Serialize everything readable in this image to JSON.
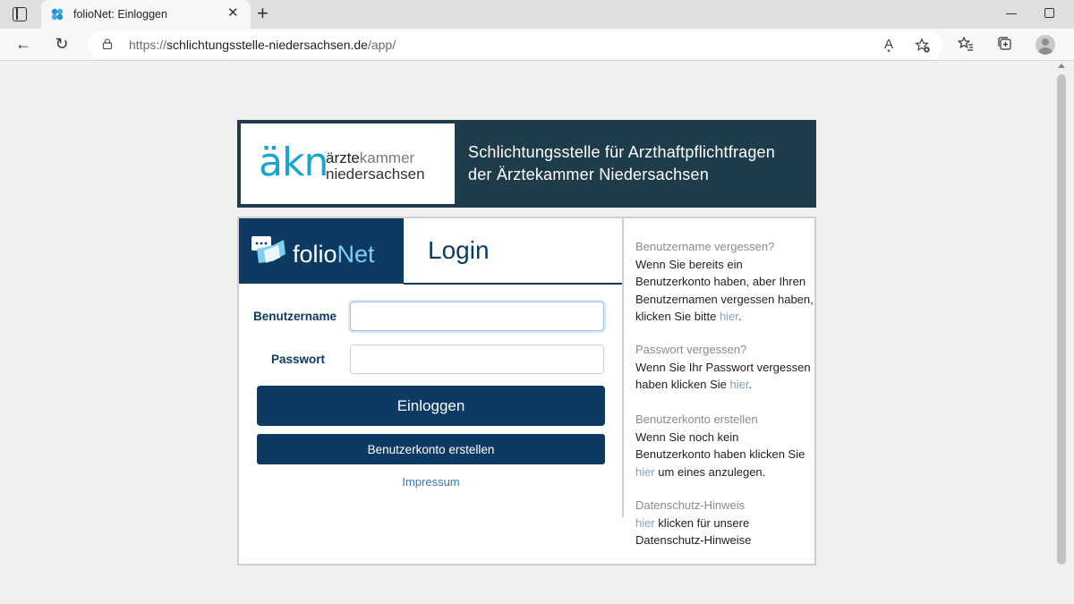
{
  "browser": {
    "tab_title": "folioNet: Einloggen",
    "tab_close": "✕",
    "new_tab": "+",
    "url_prefix": "https://",
    "url_host": "schlichtungsstelle-niedersachsen.de",
    "url_path": "/app/",
    "read_aloud": "A͓",
    "back": "←",
    "refresh": "↻"
  },
  "banner": {
    "logo_mark": "äkn",
    "logo_line1_bold": "ärzte",
    "logo_line1_light": "kammer",
    "logo_line2": "niedersachsen",
    "title_line1": "Schlichtungsstelle für Arzthaftpflichtfragen",
    "title_line2": "der Ärztekammer Niedersachsen"
  },
  "login": {
    "brand_folio": "folio",
    "brand_net": "Net",
    "title": "Login",
    "username_label": "Benutzername",
    "username_value": "",
    "password_label": "Passwort",
    "password_value": "",
    "login_button": "Einloggen",
    "register_button": "Benutzerkonto erstellen",
    "impressum": "Impressum"
  },
  "info": [
    {
      "heading": "Benutzername vergessen?",
      "text": "Wenn Sie bereits ein Benutzerkonto haben, aber Ihren Benutzernamen vergessen haben, klicken Sie bitte ",
      "link": "hier",
      "after": "."
    },
    {
      "heading": "Passwort vergessen?",
      "text": "Wenn Sie Ihr Passwort vergessen haben klicken Sie ",
      "link": "hier",
      "after": "."
    },
    {
      "heading": "Benutzerkonto erstellen",
      "text": "Wenn Sie noch kein Benutzerkonto haben klicken Sie ",
      "link": "hier",
      "after": " um eines anzulegen."
    },
    {
      "heading": "Datenschutz-Hinweis",
      "text": "",
      "link": "hier",
      "after": " klicken für unsere Datenschutz-Hinweise"
    }
  ],
  "colors": {
    "navy": "#0c3a63",
    "banner": "#1f3c4a",
    "akn_blue": "#1aa5cd",
    "folionet_accent": "#7fd0ee"
  }
}
